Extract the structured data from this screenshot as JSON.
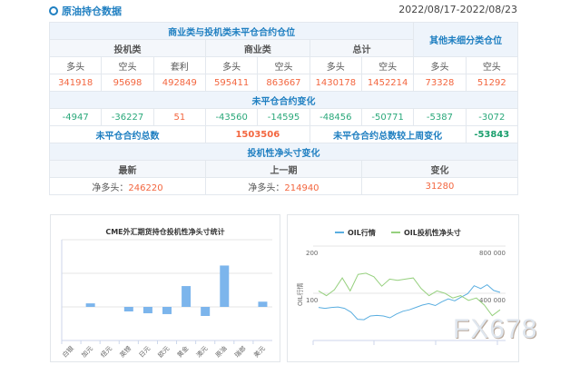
{
  "header": {
    "title": "原油持仓数据",
    "date_range": "2022/08/17-2022/08/23"
  },
  "table": {
    "group1": "商业类与投机类未平仓合约仓位",
    "group2": "其他未细分类仓位",
    "sub": [
      "投机类",
      "商业类",
      "总计"
    ],
    "cols": [
      "多头",
      "空头",
      "套利",
      "多头",
      "空头",
      "多头",
      "空头",
      "多头",
      "空头"
    ],
    "positions": [
      "341918",
      "95698",
      "492849",
      "595411",
      "863667",
      "1430178",
      "1452214",
      "73328",
      "51292"
    ],
    "change_title": "未平仓合约变化",
    "changes": [
      "-4947",
      "-36227",
      "51",
      "-43560",
      "-14595",
      "-48456",
      "-50771",
      "-5387",
      "-3072"
    ],
    "total_label": "未平仓合约总数",
    "total_value": "1503506",
    "total_change_label": "未平仓合约总数较上周变化",
    "total_change_value": "-53843",
    "net_title": "投机性净头寸变化",
    "net_headers": [
      "最新",
      "上一期",
      "变化"
    ],
    "net_prefix": "净多头：",
    "net_latest": "246220",
    "net_prev": "214940",
    "net_change": "31280"
  },
  "chart_data": [
    {
      "type": "bar",
      "title": "CME外汇期货持仓投机性净头寸统计",
      "categories": [
        "白银",
        "加元",
        "纽元",
        "英镑",
        "日元",
        "欧元",
        "黄金",
        "澳元",
        "原油",
        "瑞郎",
        "美元"
      ],
      "values": [
        0,
        21000,
        0,
        -27000,
        -38000,
        -43000,
        124000,
        -54000,
        246220,
        0,
        31000
      ],
      "ylim": [
        -200000,
        400000
      ],
      "color": "#7cb5ec"
    },
    {
      "type": "line",
      "legend": [
        "OIL行情",
        "OIL投机性净头寸"
      ],
      "ylabel": "OIL行情",
      "left_ticks": [
        "200",
        "100"
      ],
      "right_ticks": [
        "800 000",
        "400 000"
      ],
      "left_range": [
        0,
        200
      ],
      "right_range": [
        0,
        800000
      ],
      "colors": [
        "#5aaee0",
        "#96d07e"
      ],
      "series": [
        {
          "name": "OIL行情",
          "values": [
            70,
            68,
            70,
            71,
            68,
            60,
            45,
            44,
            52,
            53,
            52,
            48,
            56,
            62,
            65,
            70,
            75,
            78,
            74,
            82,
            88,
            84,
            92,
            99,
            116,
            110,
            118,
            106,
            102
          ]
        },
        {
          "name": "OIL投机性净头寸",
          "values": [
            420000,
            380000,
            430000,
            530000,
            420000,
            560000,
            570000,
            540000,
            460000,
            520000,
            510000,
            520000,
            530000,
            440000,
            380000,
            420000,
            400000,
            360000,
            380000,
            340000,
            360000,
            300000,
            210000,
            260000
          ]
        }
      ]
    }
  ]
}
